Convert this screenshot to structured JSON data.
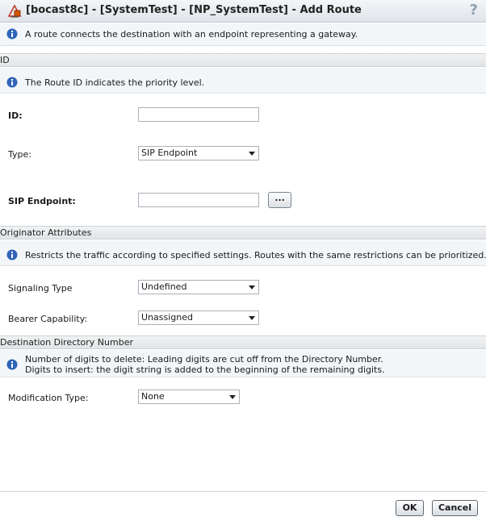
{
  "window": {
    "title": "[bocast8c] - [SystemTest] - [NP_SystemTest] - Add Route",
    "help_glyph": "?",
    "icon": "route-app-icon"
  },
  "intro": {
    "text": "A route connects the destination with an endpoint representing a gateway."
  },
  "sections": {
    "id": {
      "header": "ID",
      "info": "The Route ID indicates the priority level.",
      "id_label": "ID:",
      "id_value": "",
      "type_label": "Type:",
      "type_value": "SIP Endpoint",
      "sip_label": "SIP Endpoint:",
      "sip_value": "",
      "browse_label": "..."
    },
    "originator": {
      "header": "Originator Attributes",
      "info": "Restricts the traffic according to specified settings. Routes with the same restrictions can be prioritized.",
      "signaling_label": "Signaling Type",
      "signaling_value": "Undefined",
      "bearer_label": "Bearer Capability:",
      "bearer_value": "Unassigned"
    },
    "destination": {
      "header": "Destination Directory Number",
      "info_line1": "Number of digits to delete: Leading digits are cut off from the Directory Number.",
      "info_line2": "Digits to insert: the digit string is added to the beginning of the remaining digits.",
      "modification_label": "Modification Type:",
      "modification_value": "None"
    }
  },
  "footer": {
    "ok_label": "OK",
    "cancel_label": "Cancel"
  },
  "colors": {
    "info_icon": "#2f64b8",
    "info_bg": "#f3f6f9",
    "section_bg": "#e6e8ea"
  }
}
